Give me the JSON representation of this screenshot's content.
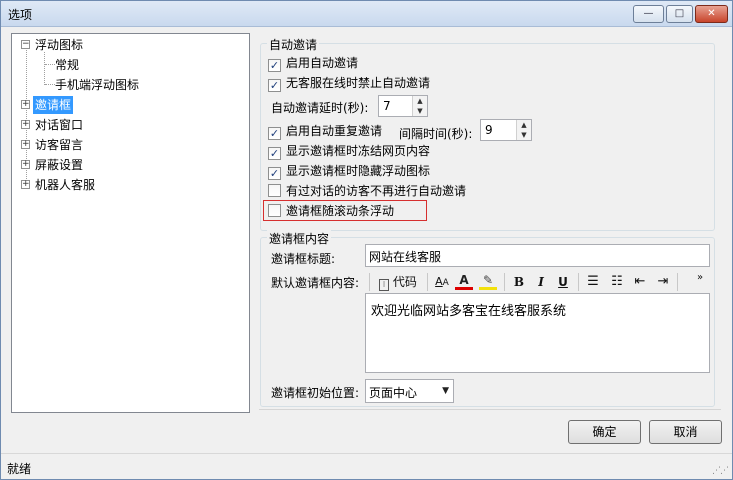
{
  "window": {
    "title": "选项",
    "minimize": "—",
    "maximize": "□",
    "close": "✕"
  },
  "tree": {
    "items": [
      {
        "label": "浮动图标",
        "expander": "−"
      },
      {
        "label": "常规"
      },
      {
        "label": "手机端浮动图标"
      },
      {
        "label": "邀请框",
        "expander": "+"
      },
      {
        "label": "对话窗口",
        "expander": "+"
      },
      {
        "label": "访客留言",
        "expander": "+"
      },
      {
        "label": "屏蔽设置",
        "expander": "+"
      },
      {
        "label": "机器人客服",
        "expander": "+"
      }
    ]
  },
  "auto_invite": {
    "legend": "自动邀请",
    "enable": {
      "label": "启用自动邀请",
      "checked": true
    },
    "no_agent": {
      "label": "无客服在线时禁止自动邀请",
      "checked": true
    },
    "delay_label": "自动邀请延时(秒):",
    "delay_value": "7",
    "repeat": {
      "label": "启用自动重复邀请",
      "checked": true
    },
    "interval_label": "间隔时间(秒):",
    "interval_value": "9",
    "freeze": {
      "label": "显示邀请框时冻结网页内容",
      "checked": true
    },
    "hide_icon": {
      "label": "显示邀请框时隐藏浮动图标",
      "checked": true
    },
    "no_reinvite": {
      "label": "有过对话的访客不再进行自动邀请",
      "checked": false
    },
    "scroll_float": {
      "label": "邀请框随滚动条浮动",
      "checked": false
    }
  },
  "invite_content": {
    "legend": "邀请框内容",
    "title_label": "邀请框标题:",
    "title_value": "网站在线客服",
    "body_label": "默认邀请框内容:",
    "code_label": "代码",
    "body_value": "欢迎光临网站多客宝在线客服系统",
    "position_label": "邀请框初始位置:",
    "position_value": "页面中心"
  },
  "buttons": {
    "ok": "确定",
    "cancel": "取消"
  },
  "status": "就绪",
  "check_mark": "✓"
}
